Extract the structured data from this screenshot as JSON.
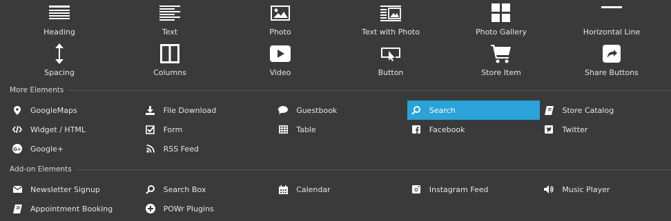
{
  "basic_elements": [
    {
      "label": "Heading",
      "icon": "heading-icon"
    },
    {
      "label": "Text",
      "icon": "text-icon"
    },
    {
      "label": "Photo",
      "icon": "photo-icon"
    },
    {
      "label": "Text with Photo",
      "icon": "text-with-photo-icon"
    },
    {
      "label": "Photo Gallery",
      "icon": "photo-gallery-icon"
    },
    {
      "label": "Horizontal Line",
      "icon": "horizontal-line-icon"
    },
    {
      "label": "Spacing",
      "icon": "spacing-icon"
    },
    {
      "label": "Columns",
      "icon": "columns-icon"
    },
    {
      "label": "Video",
      "icon": "video-icon"
    },
    {
      "label": "Button",
      "icon": "button-icon"
    },
    {
      "label": "Store Item",
      "icon": "store-item-icon"
    },
    {
      "label": "Share Buttons",
      "icon": "share-buttons-icon"
    }
  ],
  "more_elements": {
    "title": "More Elements",
    "items": [
      {
        "label": "GoogleMaps",
        "icon": "map-pin-icon"
      },
      {
        "label": "File Download",
        "icon": "file-download-icon"
      },
      {
        "label": "Guestbook",
        "icon": "guestbook-icon"
      },
      {
        "label": "Search",
        "icon": "search-icon",
        "selected": true
      },
      {
        "label": "Store Catalog",
        "icon": "store-catalog-icon"
      },
      {
        "label": "Widget / HTML",
        "icon": "code-icon"
      },
      {
        "label": "Form",
        "icon": "form-icon"
      },
      {
        "label": "Table",
        "icon": "table-icon"
      },
      {
        "label": "Facebook",
        "icon": "facebook-icon"
      },
      {
        "label": "Twitter",
        "icon": "twitter-icon"
      },
      {
        "label": "Google+",
        "icon": "google-plus-icon"
      },
      {
        "label": "RSS Feed",
        "icon": "rss-icon"
      }
    ]
  },
  "addon_elements": {
    "title": "Add-on Elements",
    "items": [
      {
        "label": "Newsletter Signup",
        "icon": "envelope-icon"
      },
      {
        "label": "Search Box",
        "icon": "search-box-icon"
      },
      {
        "label": "Calendar",
        "icon": "calendar-icon"
      },
      {
        "label": "Instagram Feed",
        "icon": "instagram-icon"
      },
      {
        "label": "Music Player",
        "icon": "music-player-icon"
      },
      {
        "label": "Appointment Booking",
        "icon": "appointment-booking-icon"
      },
      {
        "label": "POWr Plugins",
        "icon": "plus-circle-icon"
      }
    ]
  },
  "colors": {
    "background": "#3a3a3a",
    "selected": "#29a3d8",
    "text": "#e6e6e6"
  }
}
